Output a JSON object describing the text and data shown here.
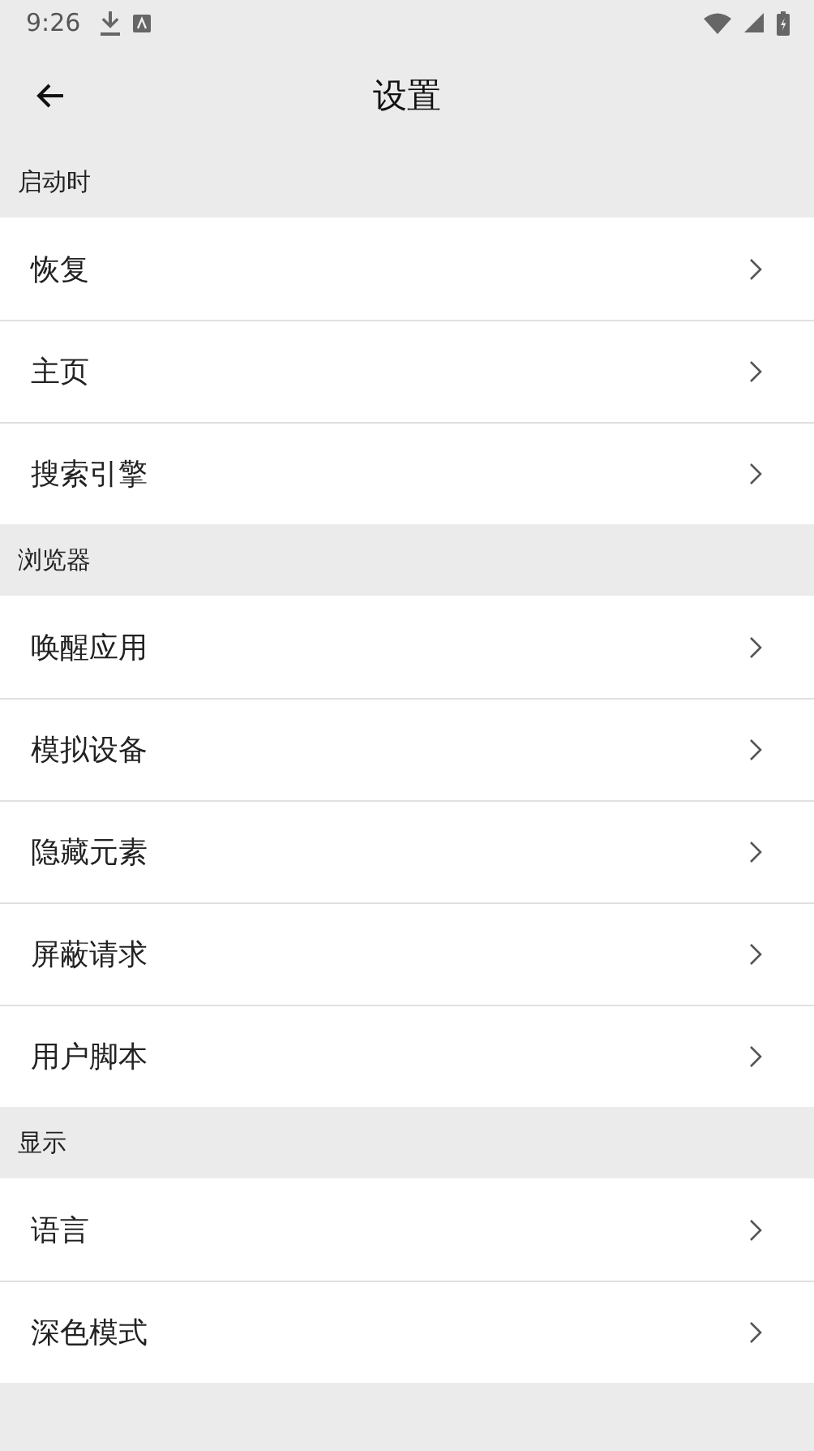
{
  "status_bar": {
    "time": "9:26"
  },
  "app_bar": {
    "title": "设置"
  },
  "sections": [
    {
      "title": "启动时",
      "items": [
        {
          "label": "恢复"
        },
        {
          "label": "主页"
        },
        {
          "label": "搜索引擎"
        }
      ]
    },
    {
      "title": "浏览器",
      "items": [
        {
          "label": "唤醒应用"
        },
        {
          "label": "模拟设备"
        },
        {
          "label": "隐藏元素"
        },
        {
          "label": "屏蔽请求"
        },
        {
          "label": "用户脚本"
        }
      ]
    },
    {
      "title": "显示",
      "items": [
        {
          "label": "语言"
        },
        {
          "label": "深色模式"
        }
      ]
    }
  ]
}
